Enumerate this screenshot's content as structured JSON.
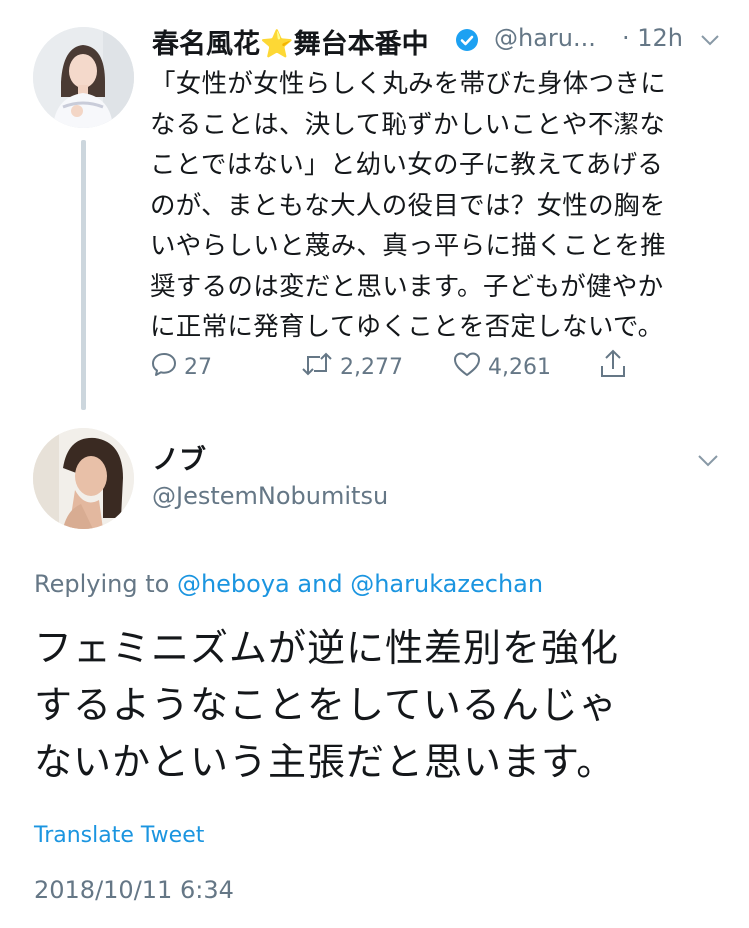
{
  "tweet1": {
    "display_name": "春名風花",
    "name_emoji": "⭐",
    "name_suffix": "舞台本番中",
    "handle": "@haru...",
    "time": "· 12h",
    "body_lines": [
      "「女性が女性らしく丸みを帯びた身体つきに",
      "なることは、決して恥ずかしいことや不潔な",
      "ことではない」と幼い女の子に教えてあげる",
      "のが、まともな大人の役目では？女性の胸を",
      "いやらしいと蔑み、真っ平らに描くことを推",
      "奨するのは変だと思います。子どもが健やか",
      "に正常に発育してゆくことを否定しないで。"
    ],
    "replies": "27",
    "retweets": "2,277",
    "likes": "4,261"
  },
  "tweet2": {
    "display_name": "ノブ",
    "handle": "@JestemNobumitsu",
    "replying_prefix": "Replying to",
    "replying_user1": "@heboya",
    "replying_and": "and",
    "replying_user2": "@harukazechan",
    "body_lines": [
      "フェミニズムが逆に性差別を強化",
      "するようなことをしているんじゃ",
      "ないかという主張だと思います。"
    ],
    "translate_label": "Translate Tweet",
    "timestamp": "2018/10/11 6:34"
  },
  "colors": {
    "accent": "#1b95e0",
    "secondary_text": "#657786",
    "thread_line": "#ccd6dd",
    "verified": "#1da1f2"
  }
}
